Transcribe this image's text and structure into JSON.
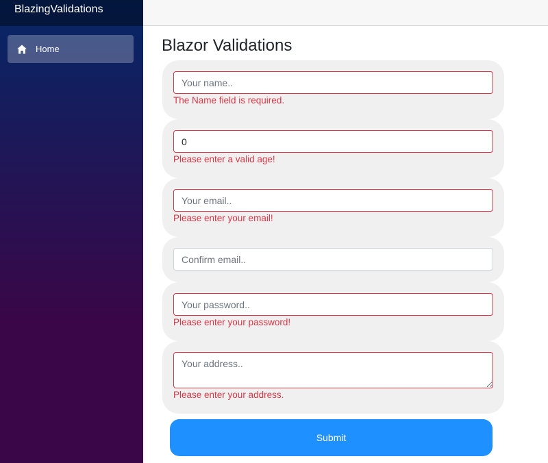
{
  "app": {
    "brand": "BlazingValidations"
  },
  "sidebar": {
    "items": [
      {
        "label": "Home",
        "icon": "home-icon"
      }
    ]
  },
  "main": {
    "title": "Blazor Validations"
  },
  "form": {
    "name": {
      "placeholder": "Your name..",
      "value": "",
      "error": "The Name field is required."
    },
    "age": {
      "placeholder": "",
      "value": "0",
      "error": "Please enter a valid age!"
    },
    "email": {
      "placeholder": "Your email..",
      "value": "",
      "error": "Please enter your email!"
    },
    "confirm_email": {
      "placeholder": "Confirm email..",
      "value": ""
    },
    "password": {
      "placeholder": "Your password..",
      "value": "",
      "error": "Please enter your password!"
    },
    "address": {
      "placeholder": "Your address..",
      "value": "",
      "error": "Please enter your address."
    },
    "submit_label": "Submit"
  },
  "colors": {
    "sidebar_top": "#052767",
    "sidebar_bottom": "#3a0647",
    "error": "#dc3545",
    "submit": "#1e90ff",
    "group_bg": "#f0f0f0"
  }
}
